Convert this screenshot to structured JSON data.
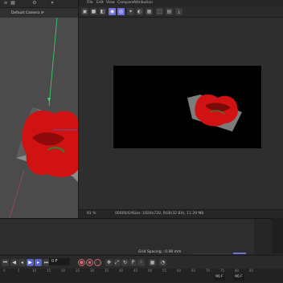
{
  "viewport": {
    "camera_label": "Default Camera",
    "camera_suffix": "⟳",
    "toolbar_icons": [
      "menu-icon",
      "grid-icon",
      "settings-icon"
    ]
  },
  "viewer": {
    "menu": [
      "File",
      "Edit",
      "View",
      "Compare",
      "Attribution"
    ],
    "status": {
      "zoom": "81 %",
      "color": "00000/GA",
      "size": "Size: 1920x720, RGB(32 Bit), 11.29 MB"
    }
  },
  "timeline": {
    "grid_spacing": "Grid Spacing : 0.08 mm",
    "current_frame": "0 F",
    "ruler_ticks": [
      "0",
      "5",
      "10",
      "15",
      "20",
      "25",
      "30",
      "35",
      "40",
      "45",
      "50",
      "55",
      "60",
      "65",
      "70",
      "75",
      "80",
      "85"
    ],
    "range_start": "90 F",
    "range_end": "90 F"
  },
  "colors": {
    "accent": "#6f72d8",
    "render_bg": "#000000",
    "object_red": "#d11212"
  }
}
